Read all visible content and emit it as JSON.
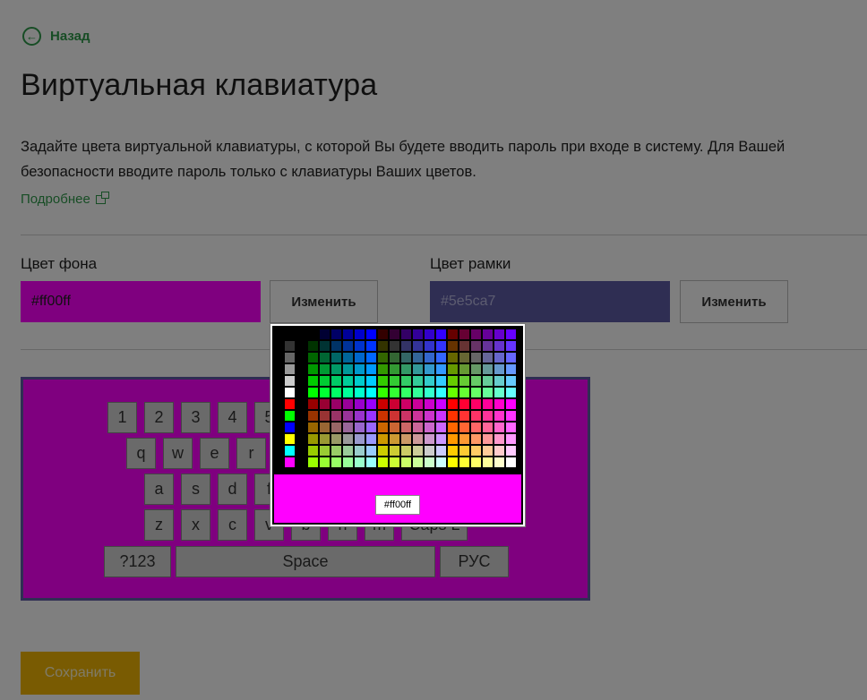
{
  "header": {
    "back_label": "Назад",
    "back_icon": "arrow-left-icon",
    "title": "Виртуальная клавиатура",
    "description": "Задайте цвета виртуальной клавиатуры, с которой Вы будете вводить пароль при входе в систему. Для Вашей безопасности вводите пароль только с клавиатуры Ваших цветов.",
    "more_link": "Подробнее",
    "more_icon": "external-link-icon"
  },
  "background_color": {
    "label": "Цвет фона",
    "value": "#ff00ff",
    "change_label": "Изменить"
  },
  "border_color": {
    "label": "Цвет рамки",
    "value": "#5e5ca7",
    "change_label": "Изменить"
  },
  "keyboard": {
    "background": "#ff00ff",
    "border": "#5e5ca7",
    "row1": [
      "1",
      "2",
      "3",
      "4",
      "5"
    ],
    "row2": [
      "q",
      "w",
      "e",
      "r"
    ],
    "row3": [
      "a",
      "s",
      "d",
      "f"
    ],
    "row4": [
      "z",
      "x",
      "c",
      "v",
      "b",
      "n",
      "m",
      "Caps L"
    ],
    "row5": [
      "?123",
      "Space",
      "РУС"
    ]
  },
  "picker": {
    "selected_hex": "#ff00ff"
  },
  "save_label": "Сохранить",
  "colors": {
    "accent": "#2f9a4a",
    "save_button": "#f2b705",
    "overlay": "rgba(0,0,0,0.5)"
  }
}
